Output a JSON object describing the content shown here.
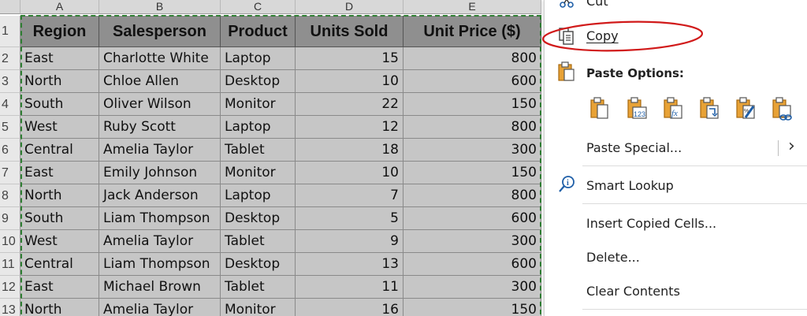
{
  "sheet": {
    "column_headers": [
      "A",
      "B",
      "C",
      "D",
      "E"
    ],
    "row_numbers": [
      "1",
      "2",
      "3",
      "4",
      "5",
      "6",
      "7",
      "8",
      "9",
      "10",
      "11",
      "12",
      "13"
    ],
    "table": {
      "headers": [
        "Region",
        "Salesperson",
        "Product",
        "Units Sold",
        "Unit Price ($)"
      ],
      "rows": [
        [
          "East",
          "Charlotte White",
          "Laptop",
          "15",
          "800"
        ],
        [
          "North",
          "Chloe Allen",
          "Desktop",
          "10",
          "600"
        ],
        [
          "South",
          "Oliver Wilson",
          "Monitor",
          "22",
          "150"
        ],
        [
          "West",
          "Ruby Scott",
          "Laptop",
          "12",
          "800"
        ],
        [
          "Central",
          "Amelia Taylor",
          "Tablet",
          "18",
          "300"
        ],
        [
          "East",
          "Emily Johnson",
          "Monitor",
          "10",
          "150"
        ],
        [
          "North",
          "Jack Anderson",
          "Laptop",
          "7",
          "800"
        ],
        [
          "South",
          "Liam Thompson",
          "Desktop",
          "5",
          "600"
        ],
        [
          "West",
          "Amelia Taylor",
          "Tablet",
          "9",
          "300"
        ],
        [
          "Central",
          "Liam Thompson",
          "Desktop",
          "13",
          "600"
        ],
        [
          "East",
          "Michael Brown",
          "Tablet",
          "11",
          "300"
        ],
        [
          "North",
          "Amelia Taylor",
          "Monitor",
          "16",
          "150"
        ]
      ]
    },
    "colors": {
      "header_fill": "#8f8f8f",
      "cell_fill": "#c6c6c6",
      "copy_marquee": "#2e7d32"
    }
  },
  "context_menu": {
    "cut": {
      "label": "Cut",
      "icon": "scissors-icon"
    },
    "copy": {
      "label": "Copy",
      "icon": "copy-icon",
      "highlighted": true
    },
    "paste_options": {
      "label": "Paste Options:",
      "icon": "clipboard-icon",
      "buttons": [
        "paste-icon",
        "paste-values-icon",
        "paste-formulas-icon",
        "paste-transpose-icon",
        "paste-formatting-icon",
        "paste-link-icon"
      ]
    },
    "paste_special": {
      "label": "Paste Special...",
      "submenu_arrow": "›"
    },
    "smart_lookup": {
      "label": "Smart Lookup",
      "icon": "search-icon"
    },
    "insert_copied_cells": {
      "label": "Insert Copied Cells..."
    },
    "delete": {
      "label": "Delete..."
    },
    "clear_contents": {
      "label": "Clear Contents"
    },
    "colors": {
      "icon_accent": "#c47e14",
      "link_blue": "#1f5fa8",
      "annotation_red": "#d11a1a"
    }
  }
}
